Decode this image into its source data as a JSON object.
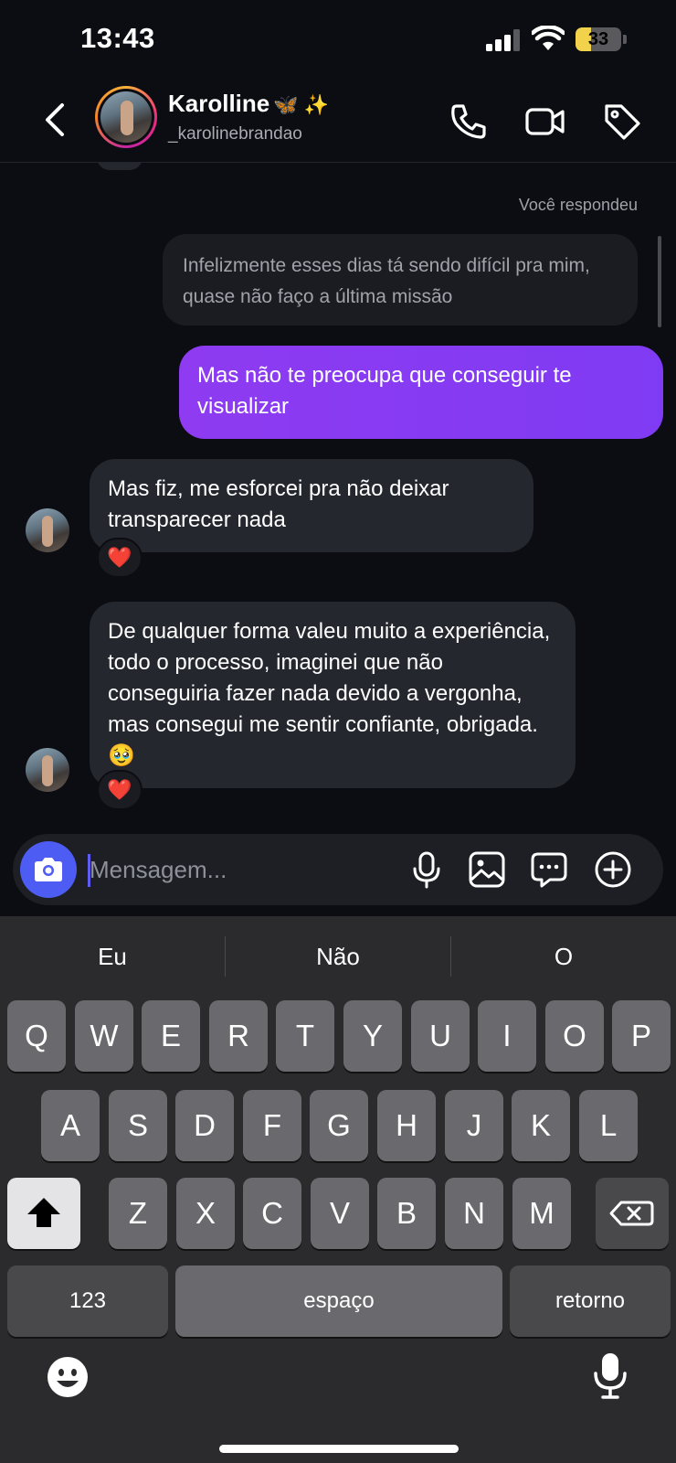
{
  "status_bar": {
    "time": "13:43",
    "battery": "33",
    "battery_level": 0.33
  },
  "header": {
    "back_icon": "chevron-left-icon",
    "name": "Karolline",
    "name_emojis": "🦋 ✨",
    "username": "_karolinebrandao",
    "icons": [
      "phone-icon",
      "video-camera-icon",
      "tag-icon"
    ]
  },
  "chat": {
    "replied_label": "Você respondeu",
    "replied_message": "Infelizmente esses dias tá sendo difícil pra mim, quase não faço a última missão",
    "sent_message": "Mas não te preocupa que conseguir te visualizar",
    "received_messages": [
      {
        "text": "Mas fiz, me esforcei pra não deixar transparecer nada",
        "reaction": "❤️"
      },
      {
        "text": "De qualquer forma valeu muito a experiência, todo o processo, imaginei que não conseguiria fazer nada devido a vergonha, mas consegui me sentir confiante, obrigada.🥹",
        "reaction": "❤️"
      }
    ]
  },
  "composer": {
    "placeholder": "Mensagem...",
    "icons": [
      "camera-icon",
      "microphone-icon",
      "gallery-icon",
      "sticker-icon",
      "plus-circle-icon"
    ]
  },
  "keyboard": {
    "suggestions": [
      "Eu",
      "Não",
      "O"
    ],
    "row1": [
      "Q",
      "W",
      "E",
      "R",
      "T",
      "Y",
      "U",
      "I",
      "O",
      "P"
    ],
    "row2": [
      "A",
      "S",
      "D",
      "F",
      "G",
      "H",
      "J",
      "K",
      "L"
    ],
    "row3": [
      "Z",
      "X",
      "C",
      "V",
      "B",
      "N",
      "M"
    ],
    "numbers_label": "123",
    "space_label": "espaço",
    "return_label": "retorno"
  }
}
